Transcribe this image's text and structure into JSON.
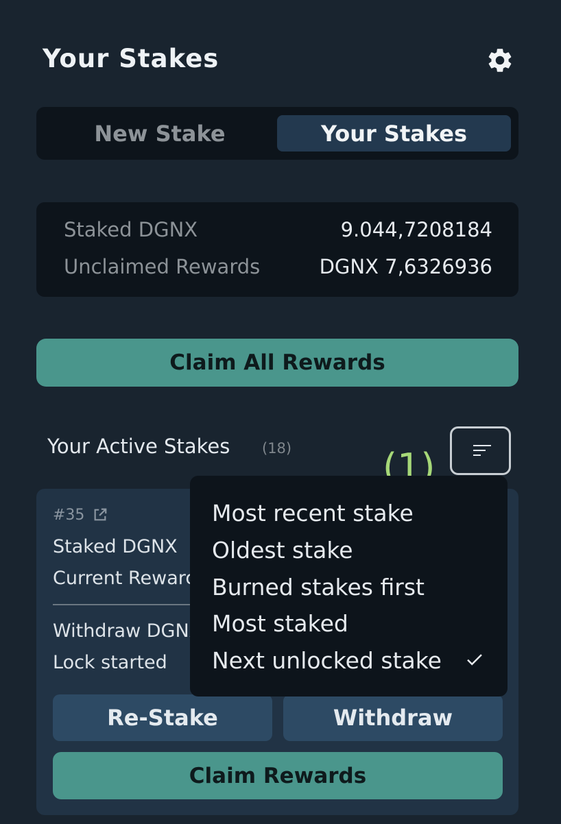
{
  "header": {
    "title": "Your Stakes",
    "settings_icon": "gear-icon"
  },
  "tabs": [
    {
      "label": "New Stake",
      "active": false
    },
    {
      "label": "Your Stakes",
      "active": true
    }
  ],
  "summary": {
    "staked_label": "Staked DGNX",
    "staked_value": "9.044,7208184",
    "rewards_label": "Unclaimed Rewards",
    "rewards_value": "DGNX  7,6326936"
  },
  "claim_all_label": "Claim All Rewards",
  "active_stakes": {
    "label": "Your Active Stakes",
    "count": "(18)",
    "sort_icon": "sort-icon"
  },
  "annotation": "(1)",
  "stake_card": {
    "id": "#35",
    "link_icon": "external-link-icon",
    "staked_label": "Staked DGNX",
    "rewards_label": "Current Rewards",
    "withdraw_label": "Withdraw DGNX",
    "lock_label": "Lock started",
    "restake_label": "Re-Stake",
    "withdraw_button": "Withdraw",
    "claim_label": "Claim Rewards"
  },
  "sort_menu": {
    "options": [
      "Most recent stake",
      "Oldest stake",
      "Burned stakes first",
      "Most staked",
      "Next unlocked stake"
    ],
    "selected": "Next unlocked stake",
    "check_icon": "check-icon"
  },
  "colors": {
    "background": "#19242f",
    "panel": "#0d141b",
    "card": "#213345",
    "accent": "#4a968c",
    "annotation": "#a6d878"
  }
}
